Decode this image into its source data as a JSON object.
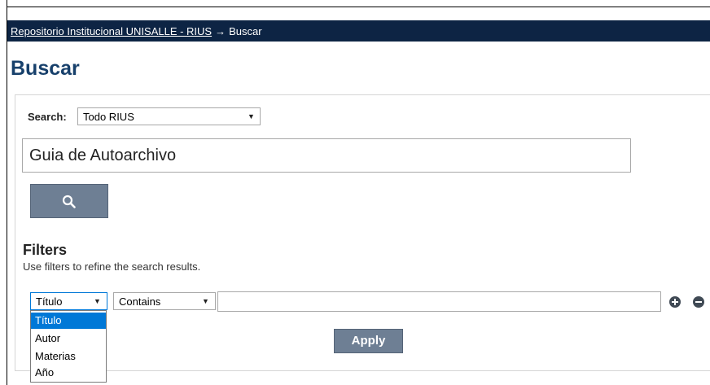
{
  "breadcrumb": {
    "home_link": "Repositorio Institucional UNISALLE - RIUS",
    "separator": "→",
    "current": "Buscar"
  },
  "page_title": "Buscar",
  "search": {
    "label": "Search:",
    "scope_value": "Todo RIUS",
    "query_value": "Guia de Autoarchivo",
    "button_icon": "search-icon"
  },
  "filters": {
    "title": "Filters",
    "help": "Use filters to refine the search results.",
    "field_value": "Título",
    "operator_value": "Contains",
    "value": "",
    "field_options": [
      "Título",
      "Autor",
      "Materias",
      "Año"
    ],
    "selected_option": "Título",
    "add_icon": "plus-circle-icon",
    "remove_icon": "minus-circle-icon",
    "apply_label": "Apply"
  },
  "colors": {
    "topbar": "#0d2444",
    "title": "#17406b",
    "button": "#6e7f94",
    "selection": "#0078d7"
  }
}
